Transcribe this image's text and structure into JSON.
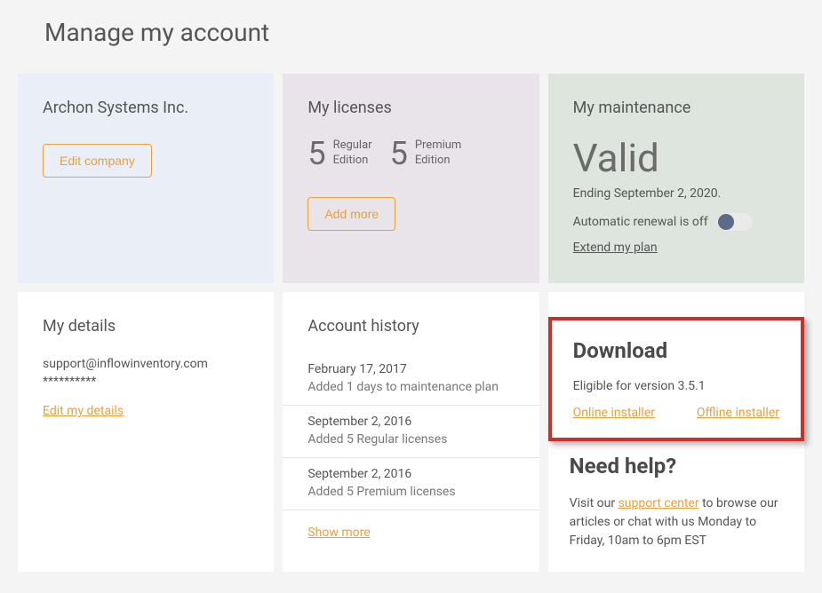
{
  "page_title": "Manage my account",
  "company": {
    "name": "Archon Systems Inc.",
    "edit_button": "Edit company"
  },
  "licenses": {
    "title": "My licenses",
    "regular": {
      "count": "5",
      "label_line1": "Regular",
      "label_line2": "Edition"
    },
    "premium": {
      "count": "5",
      "label_line1": "Premium",
      "label_line2": "Edition"
    },
    "add_button": "Add more"
  },
  "maintenance": {
    "title": "My maintenance",
    "status": "Valid",
    "ending": "Ending September 2, 2020.",
    "auto_renewal_label": "Automatic renewal is off",
    "extend_link": "Extend my plan"
  },
  "details": {
    "title": "My details",
    "email": "support@inflowinventory.com",
    "password": "**********",
    "edit_link": "Edit my details"
  },
  "history": {
    "title": "Account history",
    "items": [
      {
        "date": "February 17, 2017",
        "desc": "Added 1 days to maintenance plan"
      },
      {
        "date": "September 2, 2016",
        "desc": "Added 5 Regular licenses"
      },
      {
        "date": "September 2, 2016",
        "desc": "Added 5 Premium licenses"
      }
    ],
    "show_more": "Show more"
  },
  "download": {
    "title": "Download",
    "eligible": "Eligible for version 3.5.1",
    "online_link": "Online installer",
    "offline_link": "Offline installer"
  },
  "help": {
    "title": "Need help?",
    "prefix": "Visit our ",
    "link": "support center",
    "suffix": " to browse our articles or chat with us Monday to Friday, 10am to 6pm EST"
  }
}
